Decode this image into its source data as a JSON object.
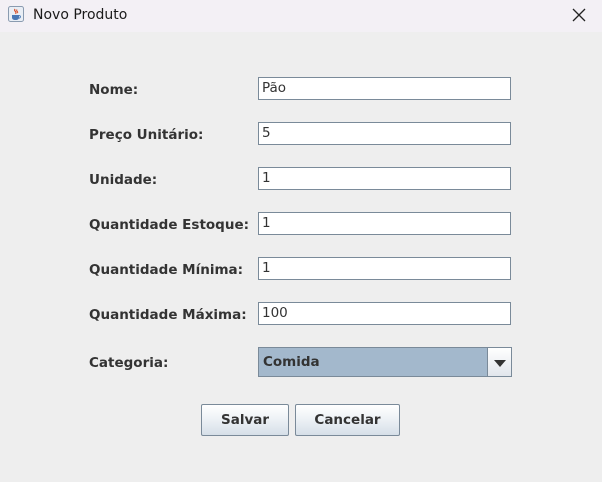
{
  "window": {
    "title": "Novo Produto",
    "app_icon": "java-cup-icon",
    "close_icon": "close-icon"
  },
  "form": {
    "fields": [
      {
        "label": "Nome:",
        "value": "Pão"
      },
      {
        "label": "Preço Unitário:",
        "value": "5"
      },
      {
        "label": "Unidade:",
        "value": "1"
      },
      {
        "label": "Quantidade Estoque:",
        "value": "1"
      },
      {
        "label": "Quantidade Mínima:",
        "value": "1"
      },
      {
        "label": "Quantidade Máxima:",
        "value": "100"
      }
    ],
    "category": {
      "label": "Categoria:",
      "selected": "Comida",
      "arrow_icon": "chevron-down-icon"
    }
  },
  "buttons": {
    "save_label": "Salvar",
    "cancel_label": "Cancelar"
  }
}
